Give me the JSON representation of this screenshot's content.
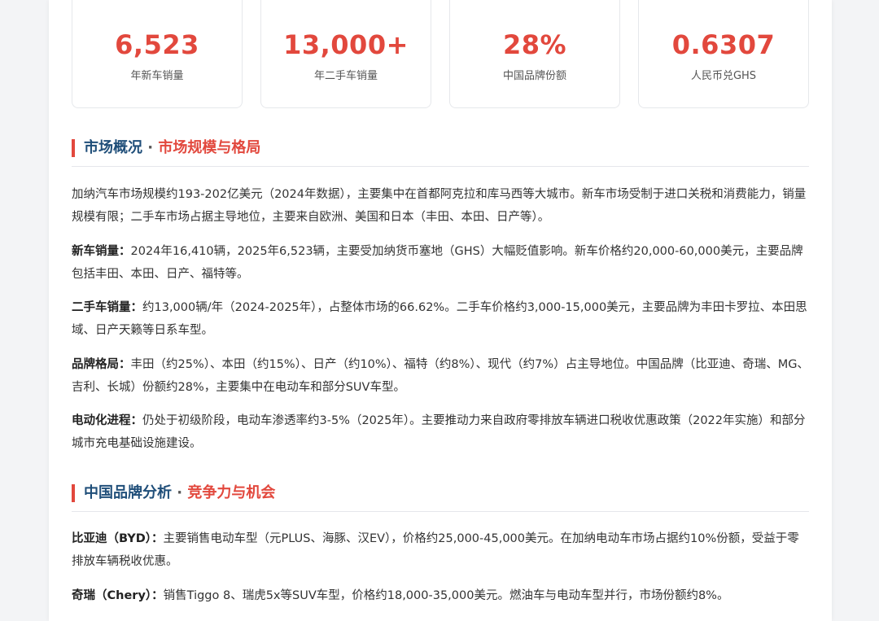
{
  "colors": {
    "accent": "#e2483d",
    "heading": "#1f4e79",
    "text": "#333333"
  },
  "stats": [
    {
      "value": "6,523",
      "label": "年新车销量"
    },
    {
      "value": "13,000+",
      "label": "年二手车销量"
    },
    {
      "value": "28%",
      "label": "中国品牌份额"
    },
    {
      "value": "0.6307",
      "label": "人民币兑GHS"
    }
  ],
  "market": {
    "title_main": "市场概况",
    "title_sep": " · ",
    "title_accent": "市场规模与格局",
    "intro": "加纳汽车市场规模约193-202亿美元（2024年数据），主要集中在首都阿克拉和库马西等大城市。新车市场受制于进口关税和消费能力，销量规模有限；二手车市场占据主导地位，主要来自欧洲、美国和日本（丰田、本田、日产等）。",
    "new_car_lead": "新车销量：",
    "new_car_text": "2024年16,410辆，2025年6,523辆，主要受加纳货币塞地（GHS）大幅贬值影响。新车价格约20,000-60,000美元，主要品牌包括丰田、本田、日产、福特等。",
    "used_car_lead": "二手车销量：",
    "used_car_text": "约13,000辆/年（2024-2025年），占整体市场的66.62%。二手车价格约3,000-15,000美元，主要品牌为丰田卡罗拉、本田思域、日产天籁等日系车型。",
    "brand_lead": "品牌格局：",
    "brand_text": "丰田（约25%）、本田（约15%）、日产（约10%）、福特（约8%）、现代（约7%）占主导地位。中国品牌（比亚迪、奇瑞、MG、吉利、长城）份额约28%，主要集中在电动车和部分SUV车型。",
    "ev_lead": "电动化进程：",
    "ev_text": "仍处于初级阶段，电动车渗透率约3-5%（2025年）。主要推动力来自政府零排放车辆进口税收优惠政策（2022年实施）和部分城市充电基础设施建设。"
  },
  "china_brands": {
    "title_main": "中国品牌分析",
    "title_sep": " · ",
    "title_accent": "竞争力与机会",
    "byd_lead": "比亚迪（BYD）：",
    "byd_text": "主要销售电动车型（元PLUS、海豚、汉EV），价格约25,000-45,000美元。在加纳电动车市场占据约10%份额，受益于零排放车辆税收优惠。",
    "chery_lead": "奇瑞（Chery）：",
    "chery_text": "销售Tiggo 8、瑞虎5x等SUV车型，价格约18,000-35,000美元。燃油车与电动车型并行，市场份额约8%。"
  }
}
